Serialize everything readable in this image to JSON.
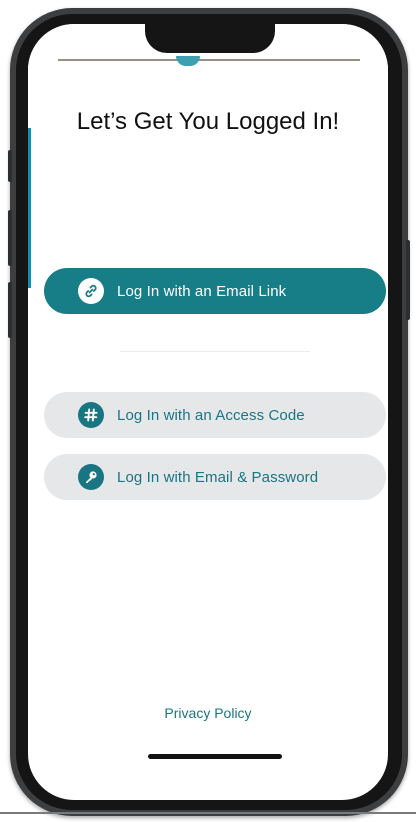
{
  "screen": {
    "title": "Let’s Get You Logged In!"
  },
  "buttons": {
    "email_link": {
      "label": "Log In with an Email Link",
      "icon": "link-icon"
    },
    "access_code": {
      "label": "Log In with an Access Code",
      "icon": "hashtag-icon"
    },
    "email_password": {
      "label": "Log In with Email & Password",
      "icon": "key-icon"
    }
  },
  "footer": {
    "privacy_label": "Privacy Policy"
  },
  "colors": {
    "primary": "#177e88",
    "secondary_bg": "#e6e7e9",
    "accent_text": "#1a7583"
  }
}
